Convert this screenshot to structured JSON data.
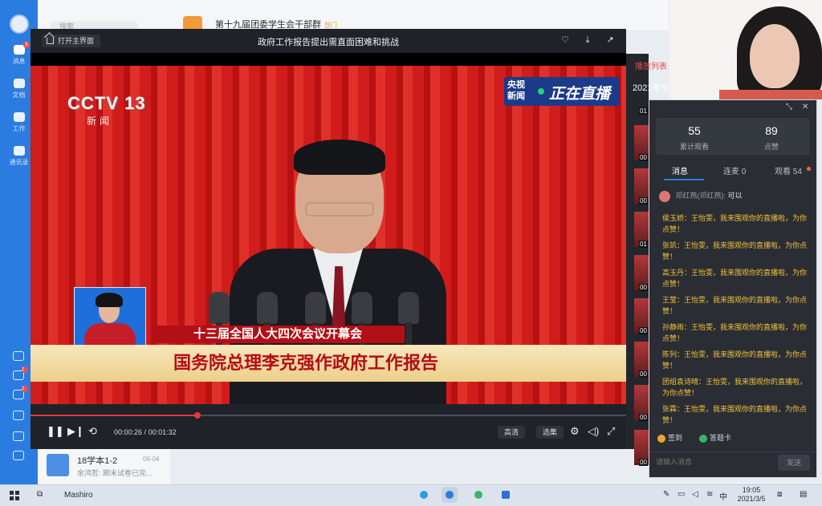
{
  "rail": {
    "items": [
      {
        "label": "消息",
        "icon": "chat-bubble-icon",
        "badge": "5"
      },
      {
        "label": "文档",
        "icon": "folder-icon"
      },
      {
        "label": "工作",
        "icon": "apps-grid-icon"
      },
      {
        "label": "通讯录",
        "icon": "contacts-icon"
      }
    ],
    "bottom_badges": [
      "1",
      "2"
    ]
  },
  "chatlist": {
    "search_placeholder": "搜索",
    "group_name": "第十九届团委学生会干部群",
    "group_tag": "部门",
    "bottom_item": {
      "name": "18学本1-2",
      "date": "06-04",
      "preview": "余鸿哲: 期末试卷已完..."
    }
  },
  "player": {
    "open_main_label": "打开主界面",
    "title": "政府工作报告提出需直面困难和挑战",
    "channel_logo": "CCTV 13",
    "channel_sub": "新闻",
    "live_badge_left": "央视\n新闻",
    "live_badge_right": "正在直播",
    "ticker_top": "十三届全国人大四次会议开幕会",
    "ticker_main": "国务院总理李克强作政府工作报告",
    "time_current": "00:00:26",
    "time_total": "00:01:32",
    "progress_fraction": 0.28,
    "btn_quality": "高清",
    "btn_select": "选集"
  },
  "playlist": {
    "title": "播放列表",
    "subtitle": "2021年全",
    "first_index": "01",
    "items": [
      "00",
      "00",
      "01",
      "00",
      "00",
      "00",
      "00",
      "00"
    ]
  },
  "live_panel": {
    "stats": [
      {
        "value": "55",
        "label": "累计观看"
      },
      {
        "value": "89",
        "label": "点赞"
      }
    ],
    "tabs": [
      {
        "label": "消息"
      },
      {
        "label": "连麦 0"
      },
      {
        "label": "观看 54"
      }
    ],
    "first_message": {
      "sender": "邓红燕(邓红燕):",
      "text": "可以"
    },
    "messages": [
      "侯玉娇：王怡雯，我来围观你的直播啦，为你点赞！",
      "张凯：王怡雯，我来围观你的直播啦，为你点赞！",
      "高玉丹：王怡雯，我来围观你的直播啦，为你点赞！",
      "王莹：王怡雯，我来围观你的直播啦，为你点赞！",
      "孙静雨：王怡雯，我来围观你的直播啦，为你点赞！",
      "陈列：王怡雯，我来围观你的直播啦，为你点赞！",
      "团组袁诗晴：王怡雯，我来围观你的直播啦，为你点赞！",
      "张霖：王怡雯，我来围观你的直播啦，为你点赞！"
    ],
    "actions": [
      {
        "label": "签到",
        "color": "#f0a531"
      },
      {
        "label": "答题卡",
        "color": "#3bb46b"
      }
    ],
    "input_placeholder": "请输入消息",
    "send_label": "发送"
  },
  "taskbar": {
    "label": "Mashiro",
    "ime": "中",
    "time": "19:05",
    "date": "2021/3/5"
  }
}
